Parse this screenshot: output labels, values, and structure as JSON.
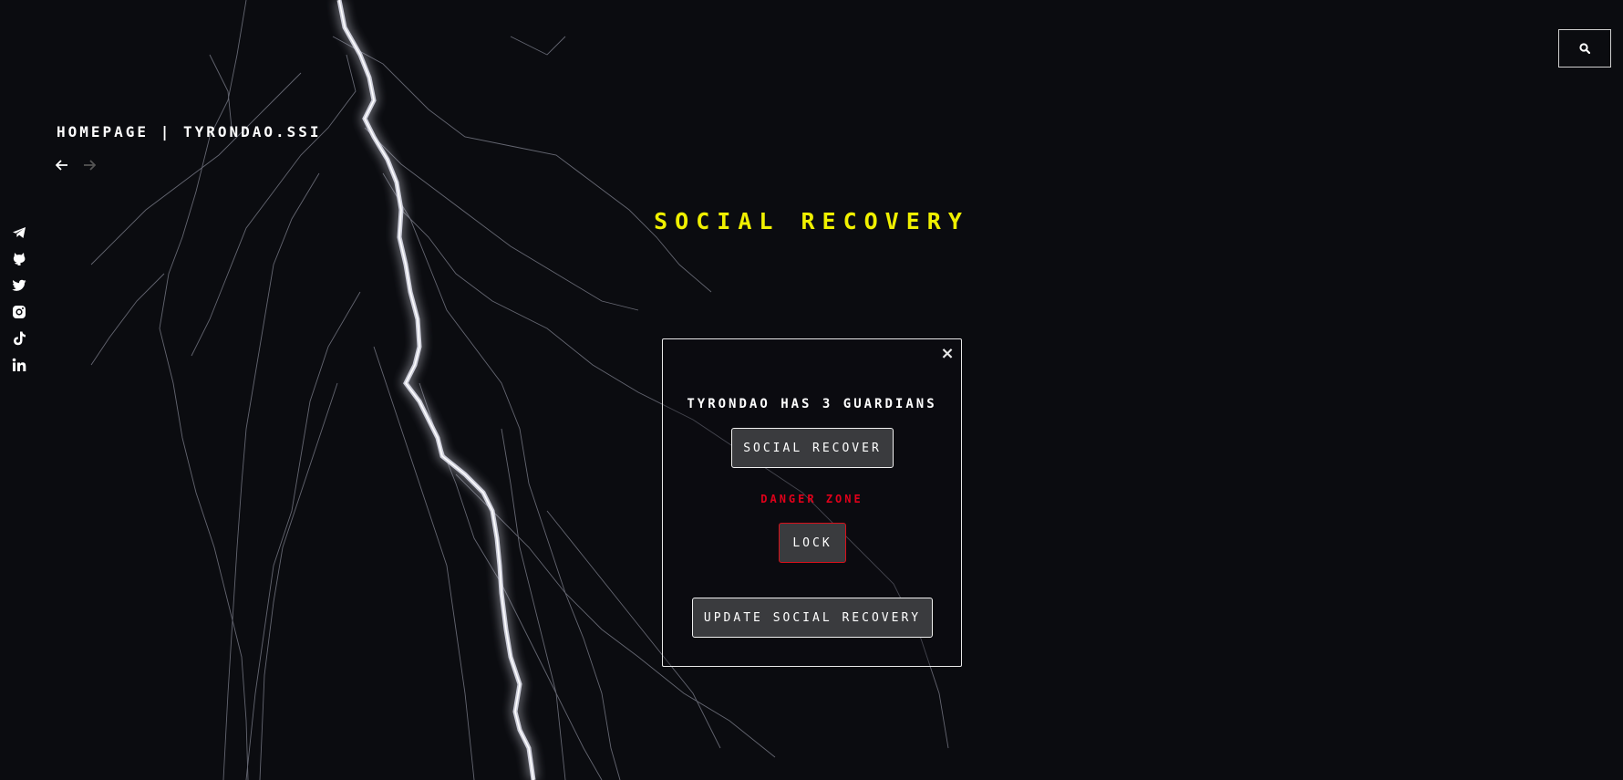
{
  "header": {
    "title": "HOMEPAGE | TYRONDAO.SSI",
    "search_icon": "search-icon",
    "back_icon": "arrow-left-icon",
    "forward_icon": "arrow-right-icon"
  },
  "social_links": [
    {
      "name": "telegram",
      "icon": "telegram-icon"
    },
    {
      "name": "github",
      "icon": "github-icon"
    },
    {
      "name": "twitter",
      "icon": "twitter-icon"
    },
    {
      "name": "instagram",
      "icon": "instagram-icon"
    },
    {
      "name": "tiktok",
      "icon": "tiktok-icon"
    },
    {
      "name": "linkedin",
      "icon": "linkedin-icon"
    }
  ],
  "main": {
    "heading": "SOCIAL RECOVERY"
  },
  "modal": {
    "close_label": "×",
    "guardians_text": "TYRONDAO HAS 3 GUARDIANS",
    "social_recover_label": "SOCIAL RECOVER",
    "danger_zone_label": "DANGER ZONE",
    "lock_label": "LOCK",
    "update_label": "UPDATE SOCIAL RECOVERY"
  },
  "colors": {
    "background": "#0b0c10",
    "heading": "#f0f000",
    "danger": "#e0001a",
    "button_bg": "#3a3b3e"
  }
}
